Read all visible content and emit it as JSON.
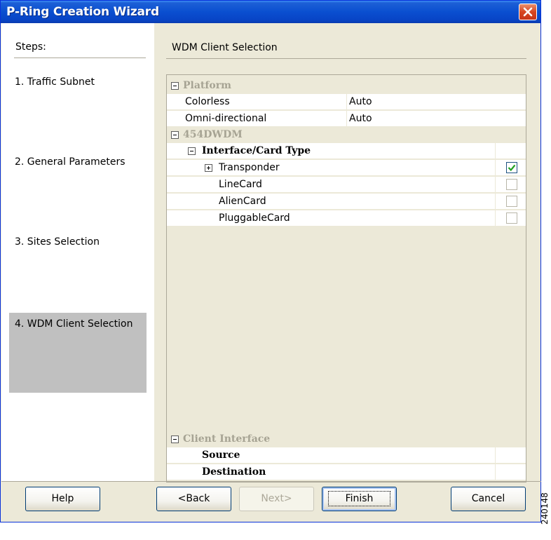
{
  "window": {
    "title": "P-Ring Creation Wizard"
  },
  "steps": {
    "header": "Steps:",
    "items": [
      {
        "label": "1. Traffic Subnet"
      },
      {
        "label": "2. General Parameters"
      },
      {
        "label": "3. Sites Selection"
      },
      {
        "label": "4. WDM Client Selection",
        "active": true
      }
    ]
  },
  "main": {
    "title": "WDM Client Selection",
    "groups": {
      "platform": {
        "label": "Platform",
        "rows": [
          {
            "name": "Colorless",
            "value": "Auto"
          },
          {
            "name": "Omni-directional",
            "value": "Auto"
          }
        ]
      },
      "dwdm": {
        "label": "454DWDM",
        "interface_card_type": {
          "label": "Interface/Card Type",
          "items": [
            {
              "name": "Transponder",
              "checked": true,
              "expandable": true
            },
            {
              "name": "LineCard",
              "checked": false
            },
            {
              "name": "AlienCard",
              "checked": false
            },
            {
              "name": "PluggableCard",
              "checked": false
            }
          ]
        }
      },
      "client_interface": {
        "label": "Client Interface",
        "rows": [
          {
            "name": "Source"
          },
          {
            "name": "Destination"
          }
        ]
      }
    }
  },
  "buttons": {
    "help": "Help",
    "back": "<Back",
    "next": "Next>",
    "finish": "Finish",
    "cancel": "Cancel"
  },
  "watermark": "240148",
  "colors": {
    "titlebar": "#0a4fd0",
    "group_label": "#a6a393",
    "check": "#21a121"
  }
}
